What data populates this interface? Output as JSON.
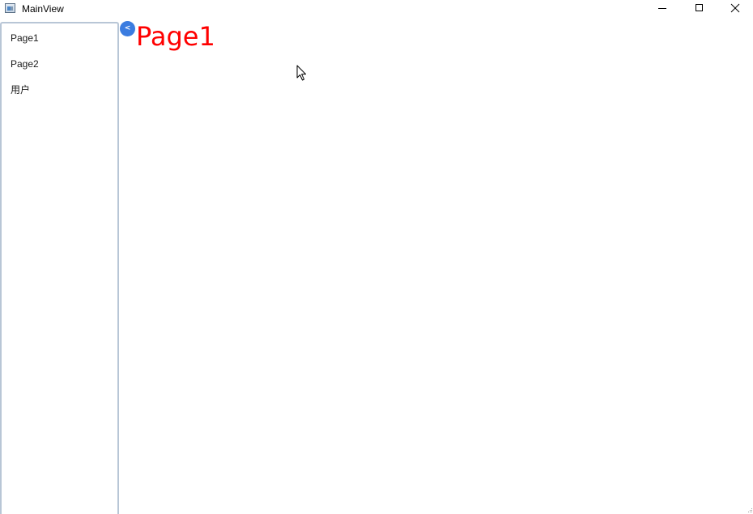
{
  "window": {
    "title": "MainView",
    "icon": "app-window-icon",
    "controls": [
      "minimize-icon",
      "maximize-icon",
      "close-icon"
    ]
  },
  "sidebar": {
    "items": [
      {
        "label": "Page1"
      },
      {
        "label": "Page2"
      },
      {
        "label": "用户"
      }
    ],
    "toggle_label": "<",
    "toggle_color": "#3b7ce0",
    "border_color": "#b8c6d6"
  },
  "main": {
    "heading": "Page1",
    "heading_color": "#ff0000"
  }
}
